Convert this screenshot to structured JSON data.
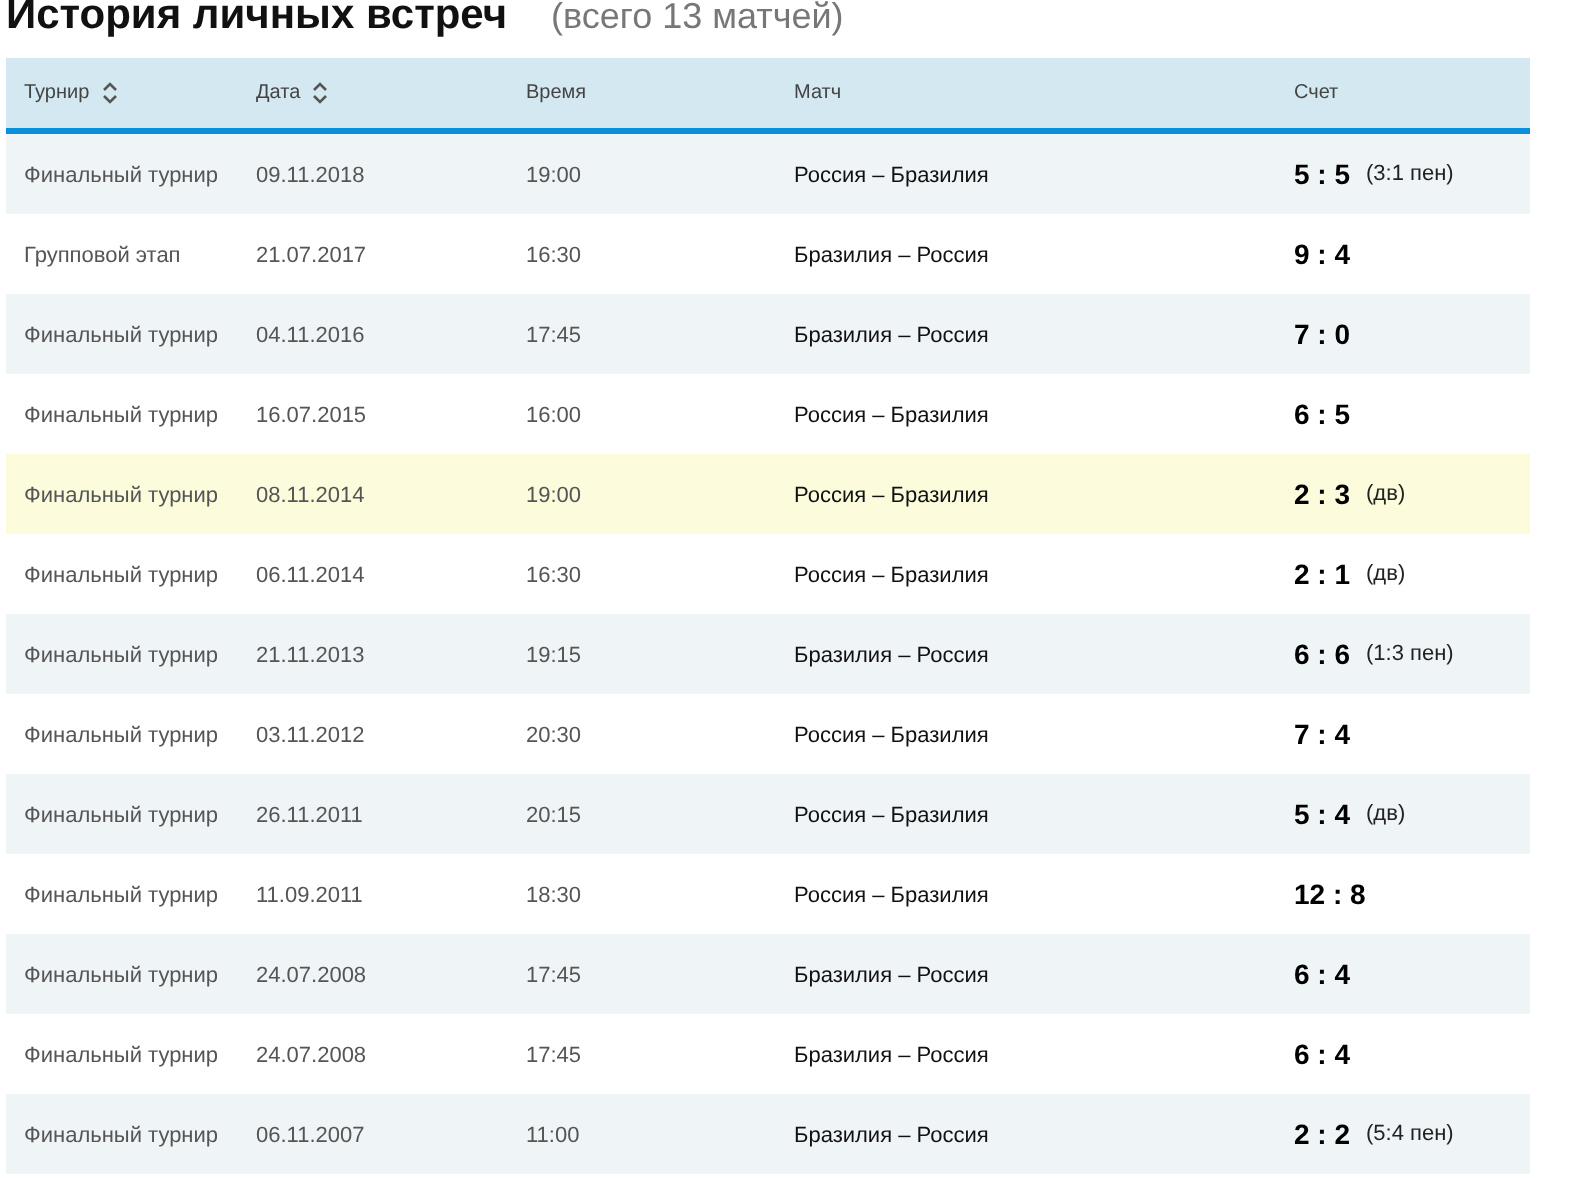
{
  "title": "История личных встреч",
  "subtitle": "(всего 13 матчей)",
  "table": {
    "columns": [
      {
        "label": "Турнир",
        "sortable": true
      },
      {
        "label": "Дата",
        "sortable": true
      },
      {
        "label": "Время",
        "sortable": false
      },
      {
        "label": "Матч",
        "sortable": false
      },
      {
        "label": "Счет",
        "sortable": false
      }
    ],
    "rows": [
      {
        "tournament": "Финальный турнир",
        "date": "09.11.2018",
        "time": "19:00",
        "match": "Россия – Бразилия",
        "score": "5 : 5",
        "note": "(3:1 пен)",
        "highlighted": false
      },
      {
        "tournament": "Групповой этап",
        "date": "21.07.2017",
        "time": "16:30",
        "match": "Бразилия – Россия",
        "score": "9 : 4",
        "highlighted": false
      },
      {
        "tournament": "Финальный турнир",
        "date": "04.11.2016",
        "time": "17:45",
        "match": "Бразилия – Россия",
        "score": "7 : 0",
        "highlighted": false
      },
      {
        "tournament": "Финальный турнир",
        "date": "16.07.2015",
        "time": "16:00",
        "match": "Россия – Бразилия",
        "score": "6 : 5",
        "highlighted": false
      },
      {
        "tournament": "Финальный турнир",
        "date": "08.11.2014",
        "time": "19:00",
        "match": "Россия – Бразилия",
        "score": "2 : 3",
        "note": "(дв)",
        "highlighted": true
      },
      {
        "tournament": "Финальный турнир",
        "date": "06.11.2014",
        "time": "16:30",
        "match": "Россия – Бразилия",
        "score": "2 : 1",
        "note": "(дв)",
        "highlighted": false
      },
      {
        "tournament": "Финальный турнир",
        "date": "21.11.2013",
        "time": "19:15",
        "match": "Бразилия – Россия",
        "score": "6 : 6",
        "note": "(1:3 пен)",
        "highlighted": false
      },
      {
        "tournament": "Финальный турнир",
        "date": "03.11.2012",
        "time": "20:30",
        "match": "Россия – Бразилия",
        "score": "7 : 4",
        "highlighted": false
      },
      {
        "tournament": "Финальный турнир",
        "date": "26.11.2011",
        "time": "20:15",
        "match": "Россия – Бразилия",
        "score": "5 : 4",
        "note": "(дв)",
        "highlighted": false
      },
      {
        "tournament": "Финальный турнир",
        "date": "11.09.2011",
        "time": "18:30",
        "match": "Россия – Бразилия",
        "score": "12 : 8",
        "highlighted": false
      },
      {
        "tournament": "Финальный турнир",
        "date": "24.07.2008",
        "time": "17:45",
        "match": "Бразилия – Россия",
        "score": "6 : 4",
        "highlighted": false
      },
      {
        "tournament": "Финальный турнир",
        "date": "24.07.2008",
        "time": "17:45",
        "match": "Бразилия – Россия",
        "score": "6 : 4",
        "highlighted": false
      },
      {
        "tournament": "Финальный турнир",
        "date": "06.11.2007",
        "time": "11:00",
        "match": "Бразилия – Россия",
        "score": "2 : 2",
        "note": "(5:4 пен)",
        "highlighted": false
      }
    ]
  }
}
